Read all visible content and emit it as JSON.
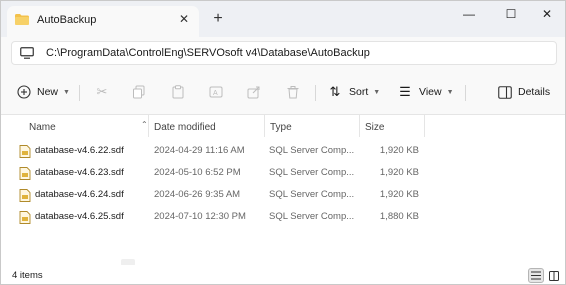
{
  "window": {
    "tab_title": "AutoBackup",
    "tab_close": "✕",
    "new_tab": "+",
    "controls": {
      "minimize": "—",
      "maximize": "☐",
      "close": "✕"
    }
  },
  "address": {
    "path": "C:\\ProgramData\\ControlEng\\SERVOsoft v4\\Database\\AutoBackup",
    "icon": "monitor-icon"
  },
  "toolbar": {
    "new_label": "New",
    "sort_label": "Sort",
    "view_label": "View",
    "details_label": "Details",
    "icons": [
      "cut-icon",
      "copy-icon",
      "paste-icon",
      "rename-icon",
      "share-icon",
      "delete-icon"
    ]
  },
  "columns": {
    "name": "Name",
    "date": "Date modified",
    "type": "Type",
    "size": "Size"
  },
  "files": [
    {
      "name": "database-v4.6.22.sdf",
      "date": "2024-04-29 11:16 AM",
      "type": "SQL Server Comp...",
      "size": "1,920 KB"
    },
    {
      "name": "database-v4.6.23.sdf",
      "date": "2024-05-10 6:52 PM",
      "type": "SQL Server Comp...",
      "size": "1,920 KB"
    },
    {
      "name": "database-v4.6.24.sdf",
      "date": "2024-06-26 9:35 AM",
      "type": "SQL Server Comp...",
      "size": "1,920 KB"
    },
    {
      "name": "database-v4.6.25.sdf",
      "date": "2024-07-10 12:30 PM",
      "type": "SQL Server Comp...",
      "size": "1,880 KB"
    }
  ],
  "status": {
    "item_count": "4 items"
  },
  "colors": {
    "accent": "#0067c0",
    "folder": "#f3c14b",
    "titlebar": "#eef0f4"
  }
}
